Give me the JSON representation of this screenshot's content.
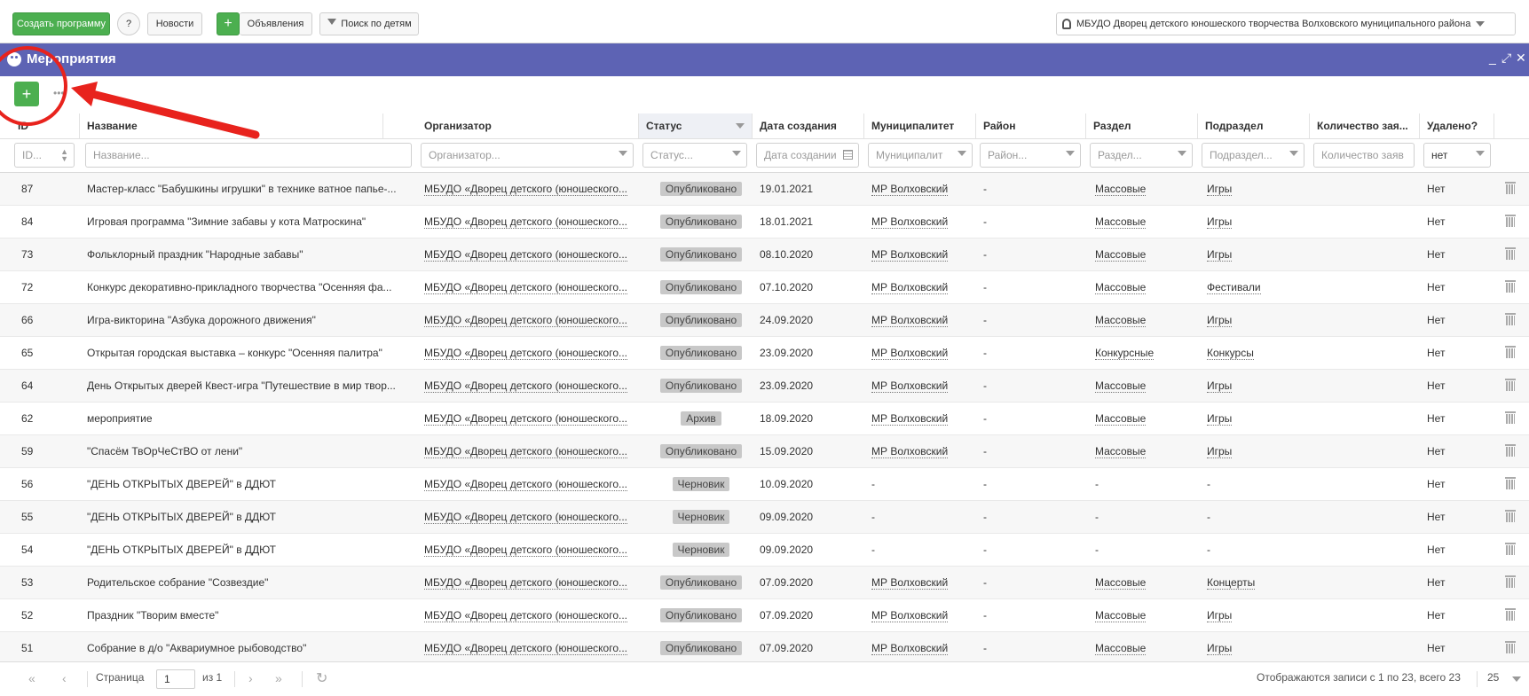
{
  "topbar": {
    "create_program": "Создать программу",
    "help": "?",
    "news": "Новости",
    "plus": "+",
    "announcements": "Объявления",
    "search_children": "Поиск по детям",
    "org_name": "МБУДО Дворец детского юношеского творчества Волховского муниципального района"
  },
  "panel": {
    "title": "Мероприятия",
    "add": "+",
    "dots": "•••",
    "minimize": "_",
    "restore": "⤢",
    "close": "✕"
  },
  "columns": [
    "ID",
    "Название",
    "Организатор",
    "Статус",
    "Дата создания",
    "Муниципалитет",
    "Район",
    "Раздел",
    "Подраздел",
    "Количество зая...",
    "Удалено?"
  ],
  "filters": {
    "id": "ID...",
    "name": "Название...",
    "organizer": "Организатор...",
    "status": "Статус...",
    "date": "Дата создании",
    "municipality": "Муниципалит",
    "district": "Район...",
    "section": "Раздел...",
    "subsection": "Подраздел...",
    "count": "Количество заяв",
    "deleted": "нет"
  },
  "rows": [
    {
      "id": "87",
      "name": "Мастер-класс \"Бабушкины игрушки\" в технике ватное папье-...",
      "org": "МБУДО «Дворец детского (юношеского...",
      "status": "Опубликовано",
      "date": "19.01.2021",
      "mun": "МР Волховский",
      "district": "-",
      "section": "Массовые",
      "sub": "Игры",
      "deleted": "Нет"
    },
    {
      "id": "84",
      "name": "Игровая программа \"Зимние забавы у кота Матроскина\"",
      "org": "МБУДО «Дворец детского (юношеского...",
      "status": "Опубликовано",
      "date": "18.01.2021",
      "mun": "МР Волховский",
      "district": "-",
      "section": "Массовые",
      "sub": "Игры",
      "deleted": "Нет"
    },
    {
      "id": "73",
      "name": "Фольклорный праздник \"Народные забавы\"",
      "org": "МБУДО «Дворец детского (юношеского...",
      "status": "Опубликовано",
      "date": "08.10.2020",
      "mun": "МР Волховский",
      "district": "-",
      "section": "Массовые",
      "sub": "Игры",
      "deleted": "Нет"
    },
    {
      "id": "72",
      "name": "Конкурс декоративно-прикладного творчества \"Осенняя фа...",
      "org": "МБУДО «Дворец детского (юношеского...",
      "status": "Опубликовано",
      "date": "07.10.2020",
      "mun": "МР Волховский",
      "district": "-",
      "section": "Массовые",
      "sub": "Фестивали",
      "deleted": "Нет"
    },
    {
      "id": "66",
      "name": "Игра-викторина \"Азбука дорожного движения\"",
      "org": "МБУДО «Дворец детского (юношеского...",
      "status": "Опубликовано",
      "date": "24.09.2020",
      "mun": "МР Волховский",
      "district": "-",
      "section": "Массовые",
      "sub": "Игры",
      "deleted": "Нет"
    },
    {
      "id": "65",
      "name": "Открытая городская выставка – конкурс \"Осенняя палитра\"",
      "org": "МБУДО «Дворец детского (юношеского...",
      "status": "Опубликовано",
      "date": "23.09.2020",
      "mun": "МР Волховский",
      "district": "-",
      "section": "Конкурсные",
      "sub": "Конкурсы",
      "deleted": "Нет"
    },
    {
      "id": "64",
      "name": "День Открытых дверей Квест-игра \"Путешествие в мир твор...",
      "org": "МБУДО «Дворец детского (юношеского...",
      "status": "Опубликовано",
      "date": "23.09.2020",
      "mun": "МР Волховский",
      "district": "-",
      "section": "Массовые",
      "sub": "Игры",
      "deleted": "Нет"
    },
    {
      "id": "62",
      "name": "мероприятие",
      "org": "МБУДО «Дворец детского (юношеского...",
      "status": "Архив",
      "date": "18.09.2020",
      "mun": "МР Волховский",
      "district": "-",
      "section": "Массовые",
      "sub": "Игры",
      "deleted": "Нет"
    },
    {
      "id": "59",
      "name": "\"Спасём ТвОрЧеСтВО от лени\"",
      "org": "МБУДО «Дворец детского (юношеского...",
      "status": "Опубликовано",
      "date": "15.09.2020",
      "mun": "МР Волховский",
      "district": "-",
      "section": "Массовые",
      "sub": "Игры",
      "deleted": "Нет"
    },
    {
      "id": "56",
      "name": "\"ДЕНЬ ОТКРЫТЫХ ДВЕРЕЙ\" в ДДЮТ",
      "org": "МБУДО «Дворец детского (юношеского...",
      "status": "Черновик",
      "date": "10.09.2020",
      "mun": "-",
      "district": "-",
      "section": "-",
      "sub": "-",
      "deleted": "Нет"
    },
    {
      "id": "55",
      "name": "\"ДЕНЬ ОТКРЫТЫХ ДВЕРЕЙ\" в ДДЮТ",
      "org": "МБУДО «Дворец детского (юношеского...",
      "status": "Черновик",
      "date": "09.09.2020",
      "mun": "-",
      "district": "-",
      "section": "-",
      "sub": "-",
      "deleted": "Нет"
    },
    {
      "id": "54",
      "name": "\"ДЕНЬ ОТКРЫТЫХ ДВЕРЕЙ\" в ДДЮТ",
      "org": "МБУДО «Дворец детского (юношеского...",
      "status": "Черновик",
      "date": "09.09.2020",
      "mun": "-",
      "district": "-",
      "section": "-",
      "sub": "-",
      "deleted": "Нет"
    },
    {
      "id": "53",
      "name": "Родительское собрание \"Созвездие\"",
      "org": "МБУДО «Дворец детского (юношеского...",
      "status": "Опубликовано",
      "date": "07.09.2020",
      "mun": "МР Волховский",
      "district": "-",
      "section": "Массовые",
      "sub": "Концерты",
      "deleted": "Нет"
    },
    {
      "id": "52",
      "name": "Праздник \"Творим вместе\"",
      "org": "МБУДО «Дворец детского (юношеского...",
      "status": "Опубликовано",
      "date": "07.09.2020",
      "mun": "МР Волховский",
      "district": "-",
      "section": "Массовые",
      "sub": "Игры",
      "deleted": "Нет"
    },
    {
      "id": "51",
      "name": "Собрание в д/о \"Аквариумное рыбоводство\"",
      "org": "МБУДО «Дворец детского (юношеского...",
      "status": "Опубликовано",
      "date": "07.09.2020",
      "mun": "МР Волховский",
      "district": "-",
      "section": "Массовые",
      "sub": "Игры",
      "deleted": "Нет"
    }
  ],
  "pager": {
    "first": "«",
    "prev": "‹",
    "page_label": "Страница",
    "page": "1",
    "of": "из 1",
    "next": "›",
    "last": "»",
    "refresh": "↻",
    "info": "Отображаются записи с 1 по 23, всего 23",
    "per_page": "25"
  },
  "colors": {
    "header": "#5d63b4",
    "green": "#4caf50",
    "annotation": "#e8231d"
  }
}
